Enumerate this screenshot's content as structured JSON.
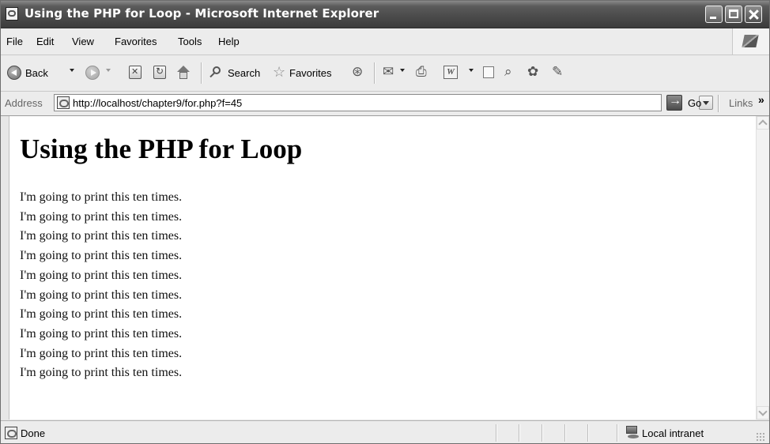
{
  "window": {
    "title": "Using the PHP for Loop - Microsoft Internet Explorer"
  },
  "menu": {
    "items": [
      "File",
      "Edit",
      "View",
      "Favorites",
      "Tools",
      "Help"
    ]
  },
  "toolbar": {
    "back_label": "Back",
    "search_label": "Search",
    "favorites_label": "Favorites"
  },
  "address": {
    "label": "Address",
    "url": "http://localhost/chapter9/for.php?f=45",
    "go_label": "Go",
    "links_label": "Links"
  },
  "page": {
    "heading": "Using the PHP for Loop",
    "lines": [
      "I'm going to print this ten times.",
      "I'm going to print this ten times.",
      "I'm going to print this ten times.",
      "I'm going to print this ten times.",
      "I'm going to print this ten times.",
      "I'm going to print this ten times.",
      "I'm going to print this ten times.",
      "I'm going to print this ten times.",
      "I'm going to print this ten times.",
      "I'm going to print this ten times."
    ]
  },
  "status": {
    "text": "Done",
    "zone": "Local intranet"
  }
}
